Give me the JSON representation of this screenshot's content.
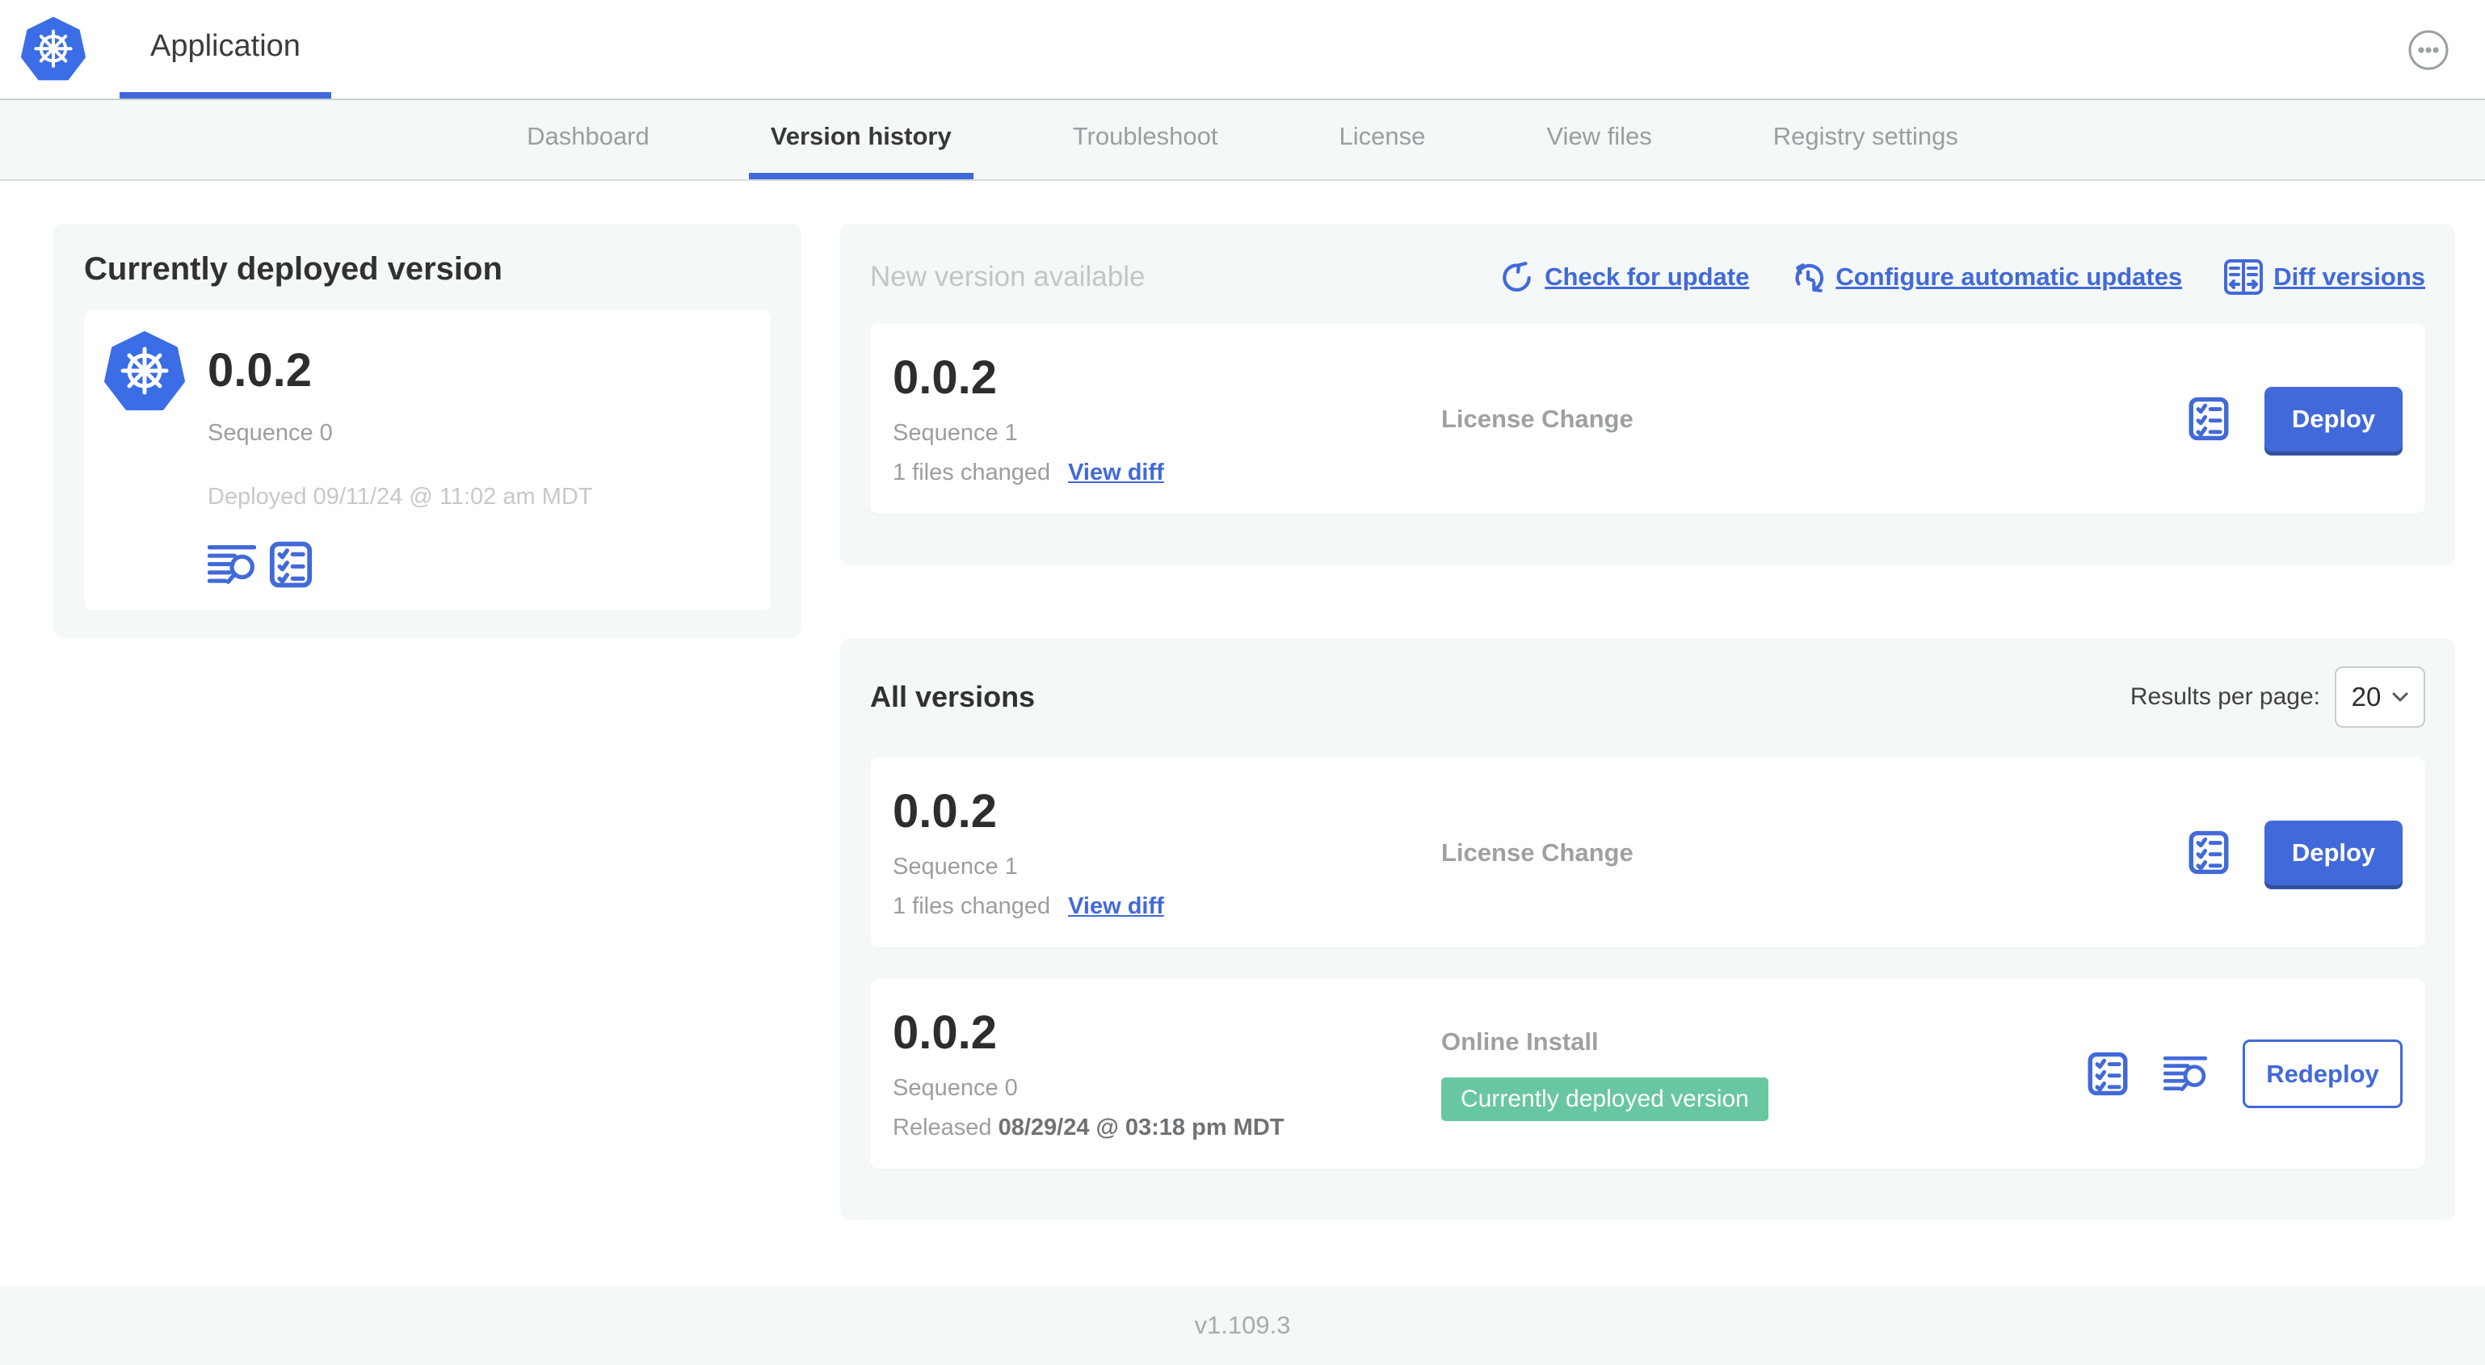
{
  "header": {
    "app_title": "Application"
  },
  "nav": {
    "tabs": [
      {
        "label": "Dashboard"
      },
      {
        "label": "Version history"
      },
      {
        "label": "Troubleshoot"
      },
      {
        "label": "License"
      },
      {
        "label": "View files"
      },
      {
        "label": "Registry settings"
      }
    ]
  },
  "current_version": {
    "title": "Currently deployed version",
    "version": "0.0.2",
    "sequence": "Sequence 0",
    "deployed": "Deployed 09/11/24 @ 11:02 am MDT"
  },
  "new_version": {
    "title": "New version available",
    "links": {
      "check": "Check for update",
      "configure": "Configure automatic updates",
      "diff": "Diff versions"
    },
    "row": {
      "version": "0.0.2",
      "sequence": "Sequence 1",
      "files_changed": "1 files changed",
      "view_diff": "View diff",
      "source": "License Change",
      "action_label": "Deploy"
    }
  },
  "all_versions": {
    "title": "All versions",
    "results_per_page_label": "Results per page:",
    "results_per_page_value": "20",
    "rows": [
      {
        "version": "0.0.2",
        "sequence": "Sequence 1",
        "files_changed": "1 files changed",
        "view_diff": "View diff",
        "source": "License Change",
        "action_label": "Deploy"
      },
      {
        "version": "0.0.2",
        "sequence": "Sequence 0",
        "released_prefix": "Released",
        "released_date": "08/29/24 @ 03:18 pm MDT",
        "source": "Online Install",
        "badge": "Currently deployed version",
        "action_label": "Redeploy"
      }
    ]
  },
  "footer": {
    "version": "v1.109.3"
  },
  "colors": {
    "blue": "#4169d9",
    "blue-dark": "#32509e",
    "k8s-blue": "#3a6de6",
    "green": "#68c7a0"
  }
}
